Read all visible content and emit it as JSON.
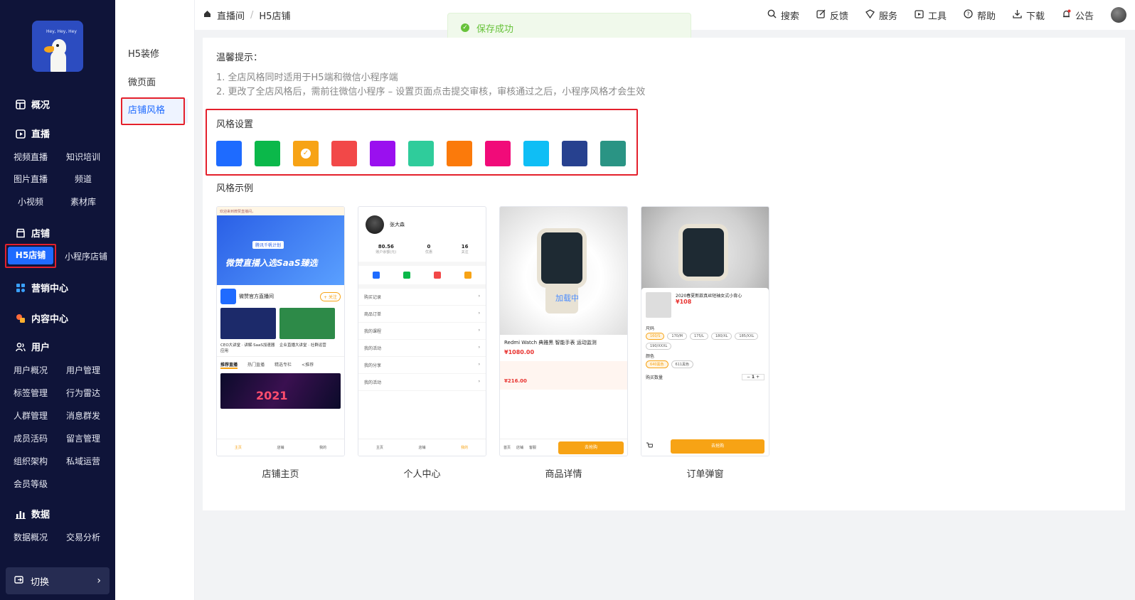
{
  "sidebar": {
    "logo_text": "Hey, Hey, Hey",
    "groups": [
      {
        "label": "概况",
        "icon": "dashboard-icon"
      },
      {
        "label": "直播",
        "icon": "live-icon"
      },
      {
        "label": "店铺",
        "icon": "store-icon"
      },
      {
        "label": "营销中心",
        "icon": "marketing-icon"
      },
      {
        "label": "内容中心",
        "icon": "content-icon"
      },
      {
        "label": "用户",
        "icon": "users-icon"
      },
      {
        "label": "数据",
        "icon": "chart-icon"
      }
    ],
    "live_items": [
      "视频直播",
      "知识培训",
      "图片直播",
      "频道",
      "小视频",
      "素材库"
    ],
    "store_items": [
      "H5店铺",
      "小程序店铺"
    ],
    "user_items": [
      "用户概况",
      "用户管理",
      "标签管理",
      "行为雷达",
      "人群管理",
      "消息群发",
      "成员活码",
      "留言管理",
      "组织架构",
      "私域运营",
      "会员等级"
    ],
    "data_items": [
      "数据概况",
      "交易分析"
    ],
    "switch_label": "切换",
    "active_color": "#1f6bff"
  },
  "subnav": {
    "items": [
      "H5装修",
      "微页面",
      "店铺风格"
    ]
  },
  "topbar": {
    "breadcrumb": [
      "直播间",
      "H5店铺"
    ],
    "actions": [
      {
        "label": "搜索",
        "icon": "search-icon"
      },
      {
        "label": "反馈",
        "icon": "edit-icon"
      },
      {
        "label": "服务",
        "icon": "service-icon"
      },
      {
        "label": "工具",
        "icon": "tool-icon"
      },
      {
        "label": "帮助",
        "icon": "help-icon"
      },
      {
        "label": "下载",
        "icon": "download-icon"
      },
      {
        "label": "公告",
        "icon": "bell-icon"
      }
    ]
  },
  "toast": {
    "message": "保存成功",
    "color": "#67c23a"
  },
  "main": {
    "tip_title": "温馨提示：",
    "tips": [
      "1. 全店风格同时适用于H5端和微信小程序端",
      "2. 更改了全店风格后，需前往微信小程序 – 设置页面点击提交审核，审核通过之后，小程序风格才会生效"
    ],
    "style_title": "风格设置",
    "swatches": [
      "#1e6bff",
      "#0bb84a",
      "#f7a315",
      "#f24848",
      "#9a10ef",
      "#2fcc9b",
      "#fb7a0b",
      "#f10b79",
      "#0fbef5",
      "#27418f",
      "#2a9484"
    ],
    "selected_swatch": "#f7a315",
    "example_title": "风格示例",
    "examples": [
      {
        "caption": "店铺主页"
      },
      {
        "caption": "个人中心"
      },
      {
        "caption": "商品详情"
      },
      {
        "caption": "订单弹窗"
      }
    ]
  },
  "phone1": {
    "notice": "欢迎来到微赞直播间，",
    "banner_title": "微赞直播入选SaaS臻选",
    "banner_tag": "腾讯千帆计划",
    "shop_name": "微赞官方直播间",
    "follow": "+ 关注",
    "captions": [
      "CEO大讲堂 · 讲解·SaaS加速器应用",
      "企业直播大讲堂 · 社群运营"
    ],
    "tabs": [
      "推荐直播",
      "热门直播",
      "精选专栏",
      "<推荐"
    ],
    "video_year": "2021",
    "tabbar": [
      "主页",
      "店铺",
      "我的"
    ]
  },
  "phone2": {
    "name": "张大森",
    "stats": [
      {
        "value": "80.56",
        "label": "账户余额(元)"
      },
      {
        "value": "0",
        "label": "优惠"
      },
      {
        "value": "16",
        "label": "关注"
      }
    ],
    "list": [
      "购买记录",
      "商品订单",
      "我的课程",
      "我的活动",
      "我的分享",
      "我的活动"
    ],
    "tabbar": [
      "主页",
      "店铺",
      "我的"
    ]
  },
  "phone3": {
    "loading": "加载中",
    "title": "Redmi Watch 典雅黑 智能手表 运动监测",
    "price": "¥1080.00",
    "live_price": "¥216.00",
    "buttons": [
      "首页",
      "店铺",
      "客服"
    ],
    "buy": "去抢购"
  },
  "phone4": {
    "title": "2020春夏新款真丝短袖女式小背心",
    "price": "¥108",
    "size_label": "尺码",
    "sizes": [
      "160/S",
      "170/M",
      "175/L",
      "180/XL",
      "185/XXL",
      "190/XXXL"
    ],
    "color_label": "颜色",
    "colors": [
      "640黑色",
      "611黑色"
    ],
    "qty_label": "购买数量",
    "qty": "1",
    "buy": "去抢购"
  }
}
